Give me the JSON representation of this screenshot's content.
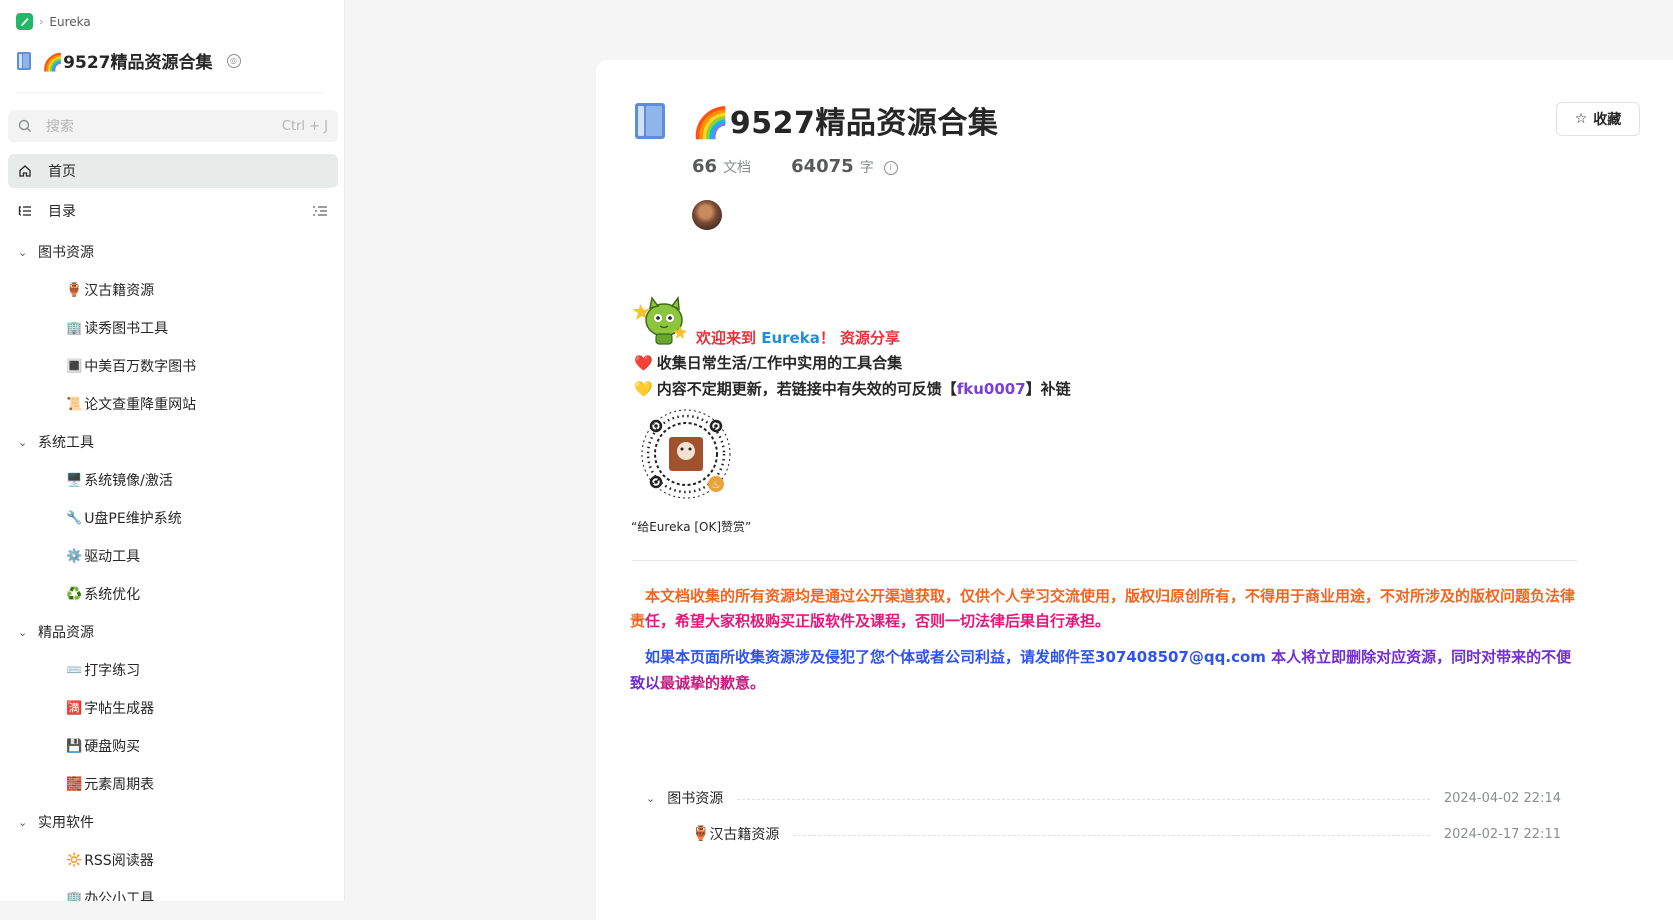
{
  "breadcrumb": {
    "app": "Eureka"
  },
  "book": {
    "title": "9527精品资源合集",
    "title_emoji": "🌈",
    "doc_count": "66",
    "doc_label": "文档",
    "word_count": "64075",
    "word_label": "字"
  },
  "sidebar": {
    "search_placeholder": "搜索",
    "search_shortcut": "Ctrl + J",
    "home_label": "首页",
    "toc_label": "目录",
    "groups": [
      {
        "label": "图书资源",
        "items": [
          {
            "emoji": "🏺",
            "label": "汉古籍资源"
          },
          {
            "emoji": "🏢",
            "label": "读秀图书工具"
          },
          {
            "emoji": "🔳",
            "label": "中美百万数字图书"
          },
          {
            "emoji": "📜",
            "label": "论文查重降重网站"
          }
        ]
      },
      {
        "label": "系统工具",
        "items": [
          {
            "emoji": "🖥️",
            "label": "系统镜像/激活"
          },
          {
            "emoji": "🔧",
            "label": "U盘PE维护系统"
          },
          {
            "emoji": "⚙️",
            "label": "驱动工具"
          },
          {
            "emoji": "♻️",
            "label": "系统优化"
          }
        ]
      },
      {
        "label": "精品资源",
        "items": [
          {
            "emoji": "⌨️",
            "label": " 打字练习"
          },
          {
            "emoji": "🈵",
            "label": "字帖生成器"
          },
          {
            "emoji": "💾",
            "label": "硬盘购买"
          },
          {
            "emoji": "🧱",
            "label": "元素周期表"
          }
        ]
      },
      {
        "label": "实用软件",
        "items": [
          {
            "emoji": "🔆",
            "label": "RSS阅读器"
          },
          {
            "emoji": "🏢",
            "label": "办公小工具"
          }
        ]
      }
    ]
  },
  "main": {
    "favorite_label": "收藏",
    "welcome_prefix": "欢迎来到 ",
    "welcome_brand": "Eureka",
    "welcome_suffix": "！ 资源分享",
    "line2_emoji": "❤️",
    "line2_text": "收集日常生活/工作中实用的工具合集",
    "line3_emoji": "💛",
    "line3_pre": "内容不定期更新，若链接中有失效的可反馈【",
    "line3_code": "fku0007",
    "line3_post": "】补链",
    "qr_caption": "“给Eureka [OK]赞赏”",
    "disclaimer_a": "　本文档收集的所有资源均是通过公开渠道获取，仅供个人学习交流使用，版权归原创所有，不得用于商业用途，不对所涉及的版权问题负法律责",
    "disclaimer_b": "任，希望大家积极购买正版软件及课程，否则一切法律后果自行承担。",
    "contact_a": "　如果本页面所收集资源涉及侵犯了您个体或者公司利益，请发邮件至307408507@qq.com",
    "contact_b": " 本人将立即删除对应资源，同时对带来的不便致以",
    "contact_c": "最诚挚的歉意。"
  },
  "toc": [
    {
      "type": "group",
      "label": "图书资源",
      "date": "2024-04-02 22:14"
    },
    {
      "type": "item",
      "emoji": "🏺",
      "label": "汉古籍资源",
      "date": "2024-02-17 22:11"
    }
  ],
  "colors": {
    "accent": "#1fb868",
    "warning": "#f26522",
    "pink": "#e6177b",
    "blue": "#2f54eb",
    "purple": "#722ed1"
  }
}
